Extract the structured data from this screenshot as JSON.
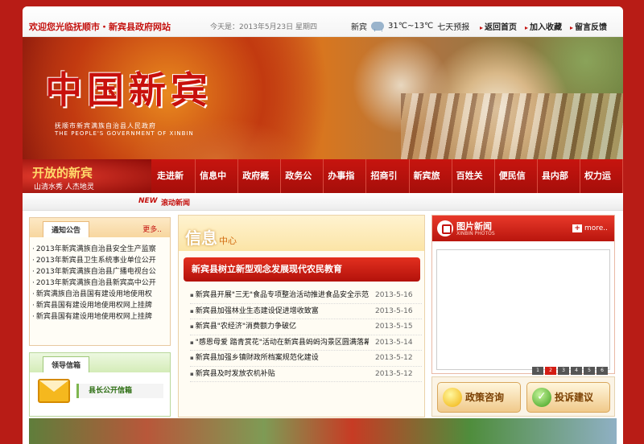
{
  "topbar": {
    "welcome": "欢迎您光临抚顺市・新宾县政府网站",
    "date": "今天是：2013年5月23日  星期四",
    "weather_city": "新宾",
    "weather_temp": "31℃~13℃",
    "weather_forecast": "七天预报",
    "links": [
      "返回首页",
      "加入收藏",
      "留言反馈"
    ]
  },
  "banner": {
    "title": "中国新宾",
    "subtitle_cn": "抚顺市新宾满族自治县人民政府",
    "subtitle_en": "THE PEOPLE'S GOVERNMENT OF XINBIN"
  },
  "nav": {
    "slogan_main": "开放的新宾",
    "slogan_sub": "山清水秀 人杰地灵",
    "items": [
      "走进新宾",
      "信息中心",
      "政府概况",
      "政务公开",
      "办事指南",
      "招商引资",
      "新宾旅游",
      "百姓关注",
      "便民信息",
      "县内部门",
      "权力运行"
    ]
  },
  "ticker": {
    "new_tag": "NEW",
    "label": "滚动新闻"
  },
  "notice": {
    "title": "通知公告",
    "more": "更多..",
    "items": [
      "2013年新宾满族自治县安全生产监察",
      "2013年新宾县卫生系统事业单位公开",
      "2013年新宾满族自治县广播电视台公",
      "2013年新宾满族自治县新宾高中公开",
      "新宾满族自治县国有建设用地使用权",
      "新宾县国有建设用地使用权网上挂牌",
      "新宾县国有建设用地使用权网上挂牌"
    ]
  },
  "leader": {
    "title": "领导信箱",
    "label": "县长公开信箱"
  },
  "info": {
    "title": "信息",
    "title_small": "中心",
    "headline": "新宾县树立新型观念发展现代农民教育",
    "news": [
      {
        "title": "新宾县开展\"三无\"食品专项整治活动推进食品安全示范…",
        "date": "2013-5-16"
      },
      {
        "title": "新宾县加强林业生态建设促进增收致富",
        "date": "2013-5-16"
      },
      {
        "title": "新宾县\"农经济\"消费额力争破亿",
        "date": "2013-5-15"
      },
      {
        "title": "\"感恩母爱 踏青赏花\"活动在新宾县蚂蚂沟景区圆满落幕",
        "date": "2013-5-14"
      },
      {
        "title": "新宾县加强乡镇财政所档案规范化建设",
        "date": "2013-5-12"
      },
      {
        "title": "新宾县及时发放农机补贴",
        "date": "2013-5-12"
      }
    ]
  },
  "photo": {
    "title": "图片新闻",
    "subtitle": "XINBIN PHOTOS",
    "more": "more..",
    "pages": [
      "1",
      "2",
      "3",
      "4",
      "5",
      "6"
    ],
    "active_page": "2"
  },
  "buttons": {
    "policy": "政策咨询",
    "complaint": "投诉建议"
  }
}
